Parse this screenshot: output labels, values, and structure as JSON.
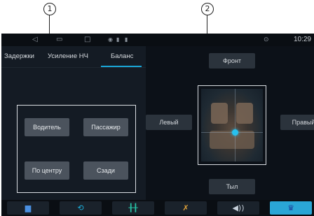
{
  "callouts": {
    "one": "1",
    "two": "2"
  },
  "statusbar": {
    "clock": "10:29"
  },
  "tabs": [
    {
      "label": "Задержки"
    },
    {
      "label": "Усиление НЧ"
    },
    {
      "label": "Баланс",
      "selected": true
    }
  ],
  "presets": {
    "driver": "Водитель",
    "passenger": "Пассажир",
    "center": "По центру",
    "rear": "Сзади"
  },
  "balance": {
    "front": "Фронт",
    "left": "Левый",
    "right": "Правый",
    "rear": "Тыл"
  },
  "icons": {
    "back": "back-icon",
    "home": "home-icon",
    "recents": "recents-icon",
    "signal": "signal-icon",
    "battery": "battery-icon",
    "location": "location-icon"
  },
  "nav": [
    {
      "icon": "save-icon",
      "active": false
    },
    {
      "icon": "refresh-icon",
      "active": false
    },
    {
      "icon": "equalizer-icon",
      "active": false
    },
    {
      "icon": "wrench-icon",
      "active": false
    },
    {
      "icon": "speaker-icon",
      "active": false
    },
    {
      "icon": "crown-icon",
      "active": true
    }
  ],
  "colors": {
    "accent": "#2aa6d6",
    "dot": "#27c1ef",
    "background": "#0c1118"
  }
}
